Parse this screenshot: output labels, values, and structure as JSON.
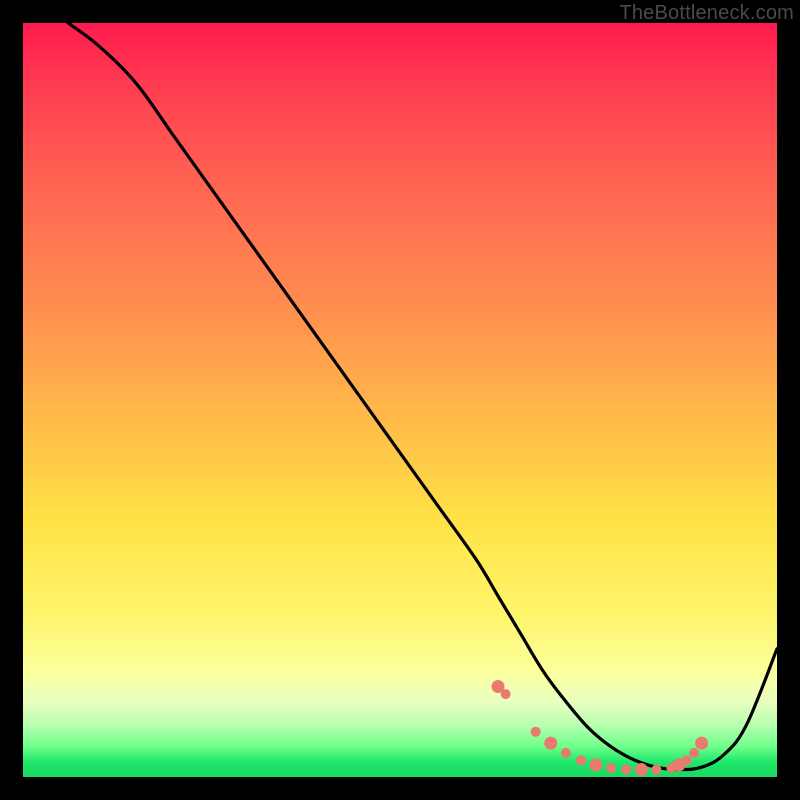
{
  "watermark": "TheBottleneck.com",
  "colors": {
    "frame": "#000000",
    "curve": "#000000",
    "marker": "#e87a6f",
    "gradient_top": "#ff1a4d",
    "gradient_bottom": "#19d864"
  },
  "chart_data": {
    "type": "line",
    "title": "",
    "xlabel": "",
    "ylabel": "",
    "xlim": [
      0,
      100
    ],
    "ylim": [
      0,
      100
    ],
    "grid": false,
    "legend": false,
    "annotations": [],
    "series": [
      {
        "name": "curve",
        "x": [
          6,
          10,
          15,
          20,
          25,
          30,
          35,
          40,
          45,
          50,
          55,
          60,
          63,
          66,
          69,
          72,
          75,
          78,
          81,
          84,
          87,
          90,
          93,
          96,
          100
        ],
        "y": [
          100,
          97,
          92,
          85,
          78,
          71,
          64,
          57,
          50,
          43,
          36,
          29,
          24,
          19,
          14,
          10,
          6.5,
          4,
          2.3,
          1.3,
          1,
          1.3,
          3,
          7,
          17
        ]
      }
    ],
    "markers": {
      "name": "highlight-points",
      "x": [
        63,
        64,
        68,
        70,
        72,
        74,
        76,
        78,
        80,
        82,
        84,
        86,
        87,
        88,
        89,
        90
      ],
      "y": [
        12,
        11,
        6,
        4.5,
        3.2,
        2.2,
        1.6,
        1.2,
        1.0,
        1.0,
        1.0,
        1.2,
        1.6,
        2.2,
        3.2,
        4.5
      ]
    }
  }
}
